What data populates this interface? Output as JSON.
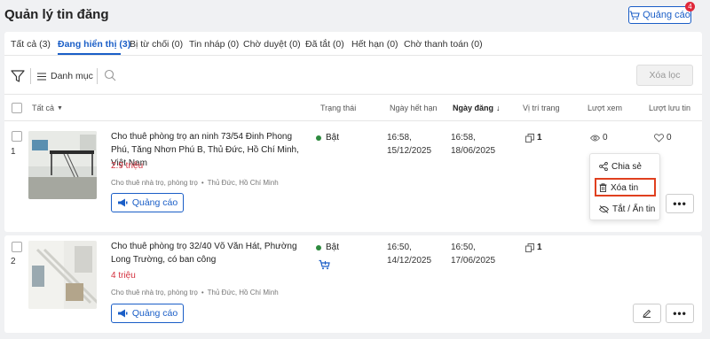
{
  "header": {
    "title": "Quản lý tin đăng",
    "ad_button_label": "Quảng cáo",
    "ad_badge": "4"
  },
  "tabs": [
    {
      "label": "Tất cả (3)",
      "active": false
    },
    {
      "label": "Đang hiển thị (3)",
      "active": true
    },
    {
      "label": "Bị từ chối (0)",
      "active": false
    },
    {
      "label": "Tin nháp (0)",
      "active": false
    },
    {
      "label": "Chờ duyệt (0)",
      "active": false
    },
    {
      "label": "Đã tắt (0)",
      "active": false
    },
    {
      "label": "Hết hạn (0)",
      "active": false
    },
    {
      "label": "Chờ thanh toán (0)",
      "active": false
    }
  ],
  "filter": {
    "category_label": "Danh mục",
    "clear_label": "Xóa lọc"
  },
  "columns": {
    "all": "Tất cả",
    "status": "Trạng thái",
    "expiry": "Ngày hết hạn",
    "posted": "Ngày đăng",
    "position": "Vị trí trang",
    "views": "Lượt xem",
    "saves": "Lượt lưu tin"
  },
  "listings": [
    {
      "index": "1",
      "title": "Cho thuê phòng trọ an ninh 73/54 Đinh Phong Phú, Tăng Nhơn Phú B, Thủ Đức, Hồ Chí Minh, Việt Nam",
      "price": "2.9 triệu",
      "category": "Cho thuê nhà trọ, phòng trọ",
      "location": "Thủ Đức, Hồ Chí Minh",
      "ad_label": "Quảng cáo",
      "status": "Bật",
      "expiry_time": "16:58,",
      "expiry_date": "15/12/2025",
      "posted_time": "16:58,",
      "posted_date": "18/06/2025",
      "position": "1",
      "views": "0",
      "saves": "0"
    },
    {
      "index": "2",
      "title": "Cho thuê phòng trọ 32/40 Võ Văn Hát, Phường Long Trường, có ban công",
      "price": "4 triệu",
      "category": "Cho thuê nhà trọ, phòng trọ",
      "location": "Thủ Đức, Hồ Chí Minh",
      "ad_label": "Quảng cáo",
      "status": "Bật",
      "expiry_time": "16:50,",
      "expiry_date": "14/12/2025",
      "posted_time": "16:50,",
      "posted_date": "17/06/2025",
      "position": "1"
    }
  ],
  "menu": {
    "share": "Chia sẻ",
    "delete": "Xóa tin",
    "toggle": "Tắt / Ẩn tin"
  },
  "colors": {
    "accent": "#1a5ec7",
    "price": "#d4313e",
    "status_on": "#2d8a3e",
    "badge": "#e0283a",
    "highlight": "#e0401f"
  }
}
